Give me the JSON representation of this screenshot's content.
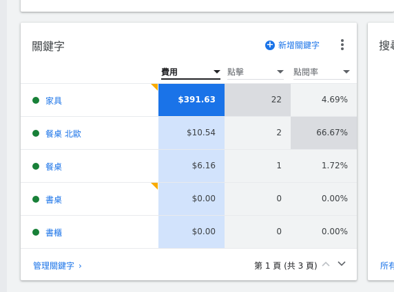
{
  "keywords_card": {
    "title": "關鍵字",
    "add_label": "新增關鍵字",
    "columns": [
      {
        "label": "費用",
        "active": true
      },
      {
        "label": "點擊",
        "active": false
      },
      {
        "label": "點閱率",
        "active": false
      }
    ],
    "rows": [
      {
        "keyword": "家具",
        "status": "enabled",
        "cost": "$391.63",
        "clicks": "22",
        "ctr": "4.69%"
      },
      {
        "keyword": "餐桌 北歐",
        "status": "enabled",
        "cost": "$10.54",
        "clicks": "2",
        "ctr": "66.67%"
      },
      {
        "keyword": "餐桌",
        "status": "enabled",
        "cost": "$6.16",
        "clicks": "1",
        "ctr": "1.72%"
      },
      {
        "keyword": "書桌",
        "status": "enabled",
        "cost": "$0.00",
        "clicks": "0",
        "ctr": "0.00%"
      },
      {
        "keyword": "書櫃",
        "status": "enabled",
        "cost": "$0.00",
        "clicks": "0",
        "ctr": "0.00%"
      }
    ],
    "manage_link": "管理關鍵字",
    "pagination": "第 1 頁 (共 3 頁)"
  },
  "right_card": {
    "title_partial": "搜尋",
    "footer_partial": "所有"
  },
  "colors": {
    "accent": "#1a73e8",
    "status_green": "#188038",
    "warning": "#f9ab00",
    "heat_light_blue": "#d2e3fc"
  },
  "icons": {
    "add": "add-circle-icon",
    "more": "more-vert-icon",
    "sort": "caret-down-icon",
    "manage": "chevron-right-icon",
    "prev": "chevron-up-icon",
    "next": "chevron-down-icon"
  }
}
